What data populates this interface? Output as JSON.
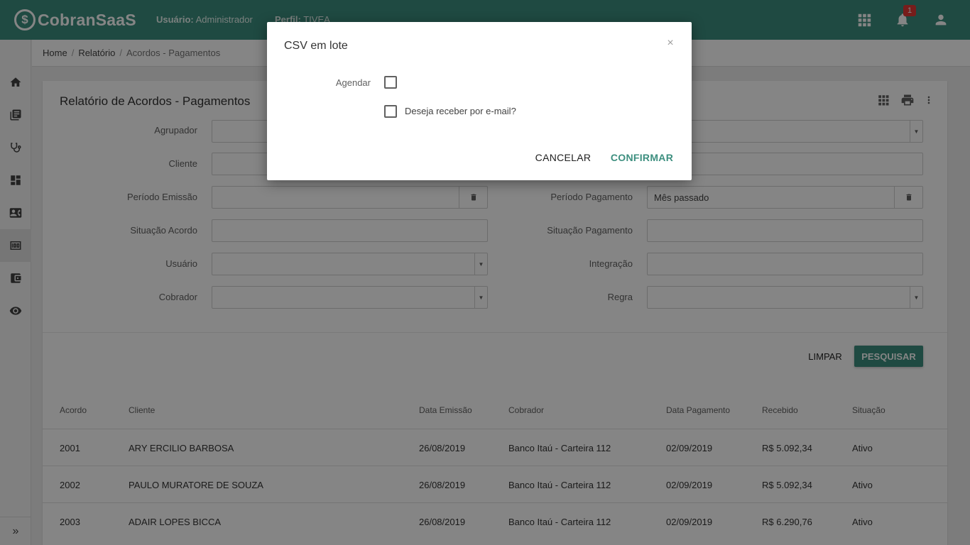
{
  "app": {
    "logo_mark": "$",
    "name": "CobranSaaS"
  },
  "topbar": {
    "user_label": "Usuário:",
    "user_value": "Administrador",
    "profile_label": "Perfil:",
    "profile_value": "TIVEA",
    "notification_count": "1",
    "icons": [
      "apps-grid-icon",
      "bell-icon",
      "account-icon"
    ]
  },
  "sidebar": {
    "items": [
      "home-icon",
      "library-books-icon",
      "stethoscope-icon",
      "dashboard-icon",
      "contact-card-icon",
      "money-icon",
      "wallet-icon",
      "eye-icon"
    ],
    "active_item": "money-icon",
    "expand_label": "»"
  },
  "breadcrumb": {
    "items": [
      "Home",
      "Relatório",
      "Acordos - Pagamentos"
    ],
    "separator": "/"
  },
  "page": {
    "title": "Relatório de Acordos - Pagamentos",
    "tools": [
      "grid-icon",
      "print-icon",
      "more-vert-icon"
    ]
  },
  "filters": {
    "agrupador": {
      "label": "Agrupador",
      "value": ""
    },
    "cliente": {
      "label": "Cliente",
      "value": ""
    },
    "periodo_emissao": {
      "label": "Período Emissão",
      "value": ""
    },
    "situacao_acordo": {
      "label": "Situação Acordo",
      "value": ""
    },
    "usuario": {
      "label": "Usuário",
      "value": ""
    },
    "cobrador": {
      "label": "Cobrador",
      "value": ""
    },
    "periodo_pagamento": {
      "label": "Período Pagamento",
      "value": "Mês passado"
    },
    "situacao_pagamento": {
      "label": "Situação Pagamento",
      "value": ""
    },
    "integracao": {
      "label": "Integração",
      "value": ""
    },
    "regra": {
      "label": "Regra",
      "value": ""
    }
  },
  "actions": {
    "clear_label": "LIMPAR",
    "search_label": "PESQUISAR"
  },
  "table": {
    "headers": [
      "Acordo",
      "Cliente",
      "Data Emissão",
      "Cobrador",
      "Data Pagamento",
      "Recebido",
      "Situação"
    ],
    "rows": [
      [
        "2001",
        "ARY ERCILIO BARBOSA",
        "26/08/2019",
        "Banco Itaú - Carteira 112",
        "02/09/2019",
        "R$ 5.092,34",
        "Ativo"
      ],
      [
        "2002",
        "PAULO MURATORE DE SOUZA",
        "26/08/2019",
        "Banco Itaú - Carteira 112",
        "02/09/2019",
        "R$ 5.092,34",
        "Ativo"
      ],
      [
        "2003",
        "ADAIR LOPES BICCA",
        "26/08/2019",
        "Banco Itaú - Carteira 112",
        "02/09/2019",
        "R$ 6.290,76",
        "Ativo"
      ]
    ]
  },
  "modal": {
    "title": "CSV em lote",
    "close_label": "×",
    "schedule_label": "Agendar",
    "schedule_checked": false,
    "email_label": "Deseja receber por e-mail?",
    "email_checked": false,
    "cancel_label": "CANCELAR",
    "confirm_label": "CONFIRMAR"
  },
  "colors": {
    "primary": "#3d8f7f",
    "badge": "#e53935"
  }
}
